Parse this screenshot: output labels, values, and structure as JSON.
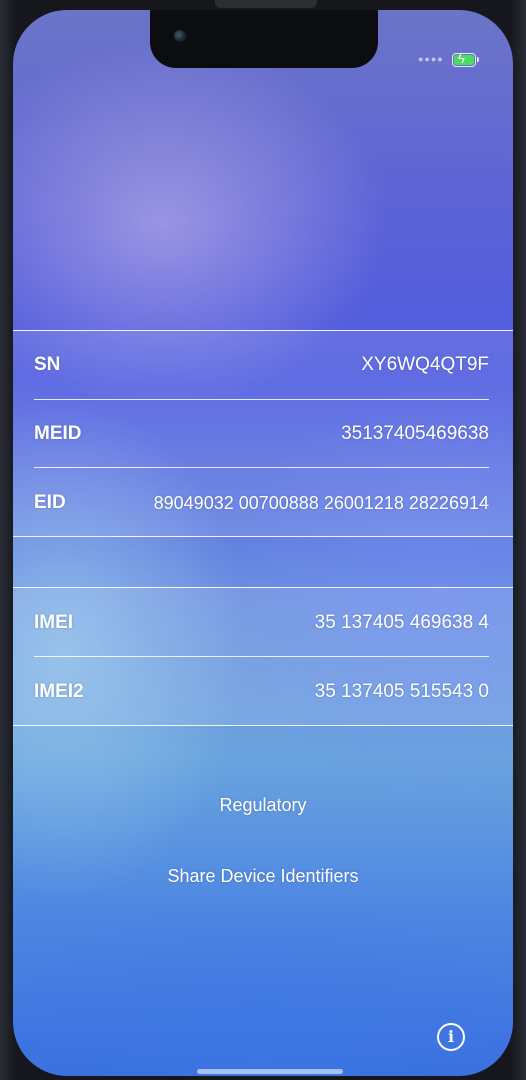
{
  "status_bar": {
    "signal_icon": "signal-dots-icon",
    "battery_icon": "battery-charging-icon",
    "battery_color": "#4cd964"
  },
  "identifiers": {
    "sn": {
      "label": "SN",
      "value": "XY6WQ4QT9F"
    },
    "meid": {
      "label": "MEID",
      "value": "35137405469638"
    },
    "eid": {
      "label": "EID",
      "value": "89049032 00700888 26001218 28226914"
    },
    "imei": {
      "label": "IMEI",
      "value": "35 137405 469638 4"
    },
    "imei2": {
      "label": "IMEI2",
      "value": "35 137405 515543 0"
    }
  },
  "links": {
    "regulatory": "Regulatory",
    "share_identifiers": "Share Device Identifiers"
  },
  "info_button": {
    "icon": "info-icon",
    "glyph": "i"
  }
}
